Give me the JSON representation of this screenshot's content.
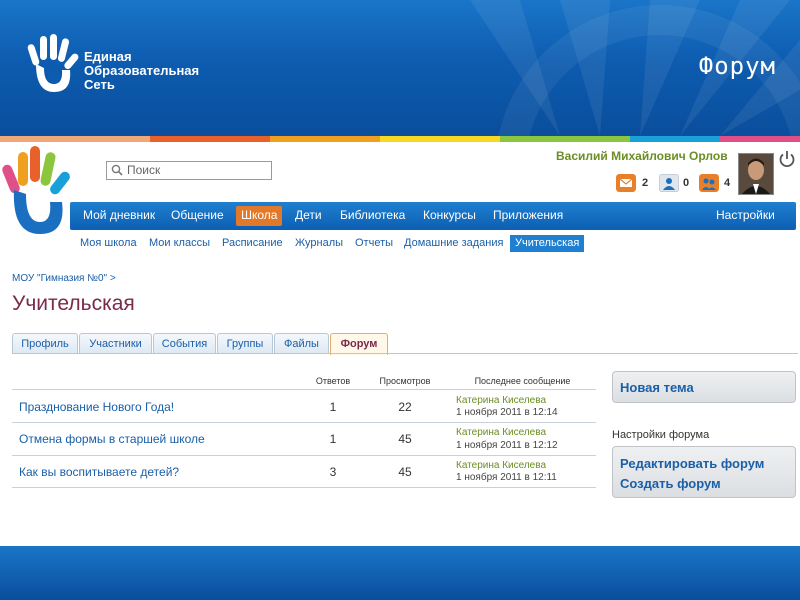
{
  "slide": {
    "title": "Форум",
    "brand_lines": [
      "Единая",
      "Образовательная",
      "Сеть"
    ]
  },
  "stripe_colors": [
    "#f0a878",
    "#e8602a",
    "#f0a020",
    "#f8d820",
    "#8cc63e",
    "#1aa0d8",
    "#e05088"
  ],
  "header": {
    "search_placeholder": "Поиск",
    "user_name": "Василий Михайлович Орлов",
    "counters": [
      {
        "icon": "mail-icon",
        "value": "2"
      },
      {
        "icon": "friends-icon",
        "value": "0"
      },
      {
        "icon": "groups-icon",
        "value": "4"
      }
    ]
  },
  "nav": {
    "items": [
      "Мой дневник",
      "Общение",
      "Школа",
      "Дети",
      "Библиотека",
      "Конкурсы",
      "Приложения"
    ],
    "active": "Школа",
    "settings": "Настройки"
  },
  "subnav": {
    "items": [
      "Моя школа",
      "Мои классы",
      "Расписание",
      "Журналы",
      "Отчеты",
      "Домашние задания",
      "Учительская"
    ],
    "active": "Учительская"
  },
  "breadcrumb": "МОУ \"Гимназия №0\"  >",
  "page_title": "Учительская",
  "tabs": {
    "items": [
      "Профиль",
      "Участники",
      "События",
      "Группы",
      "Файлы",
      "Форум"
    ],
    "active": "Форум"
  },
  "forum_table": {
    "headers": {
      "replies": "Ответов",
      "views": "Просмотров",
      "last": "Последнее сообщение"
    },
    "rows": [
      {
        "topic": "Празднование Нового Года!",
        "replies": "1",
        "views": "22",
        "author": "Катерина Киселева",
        "date": "1 ноября 2011 в 12:14"
      },
      {
        "topic": "Отмена формы в старшей школе",
        "replies": "1",
        "views": "45",
        "author": "Катерина Киселева",
        "date": "1 ноября 2011 в 12:12"
      },
      {
        "topic": "Как вы воспитываете детей?",
        "replies": "3",
        "views": "45",
        "author": "Катерина Киселева",
        "date": "1 ноября 2011 в 12:11"
      }
    ]
  },
  "sidebar": {
    "new_topic": "Новая тема",
    "settings_label": "Настройки форума",
    "edit_forum": "Редактировать форум",
    "create_forum": "Создать форум"
  }
}
